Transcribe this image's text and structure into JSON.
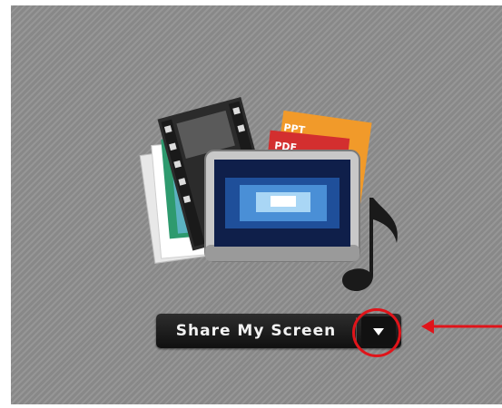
{
  "share_button": {
    "label": "Share My Screen",
    "dropdown_icon": "triangle-down-icon"
  },
  "doc_tags": {
    "ppt": "PPT",
    "pdf": "PDF"
  },
  "annotation": {
    "color": "#e0141a"
  },
  "icons": [
    "film-strip-icon",
    "document-icon",
    "monitor-icon",
    "music-note-icon"
  ]
}
